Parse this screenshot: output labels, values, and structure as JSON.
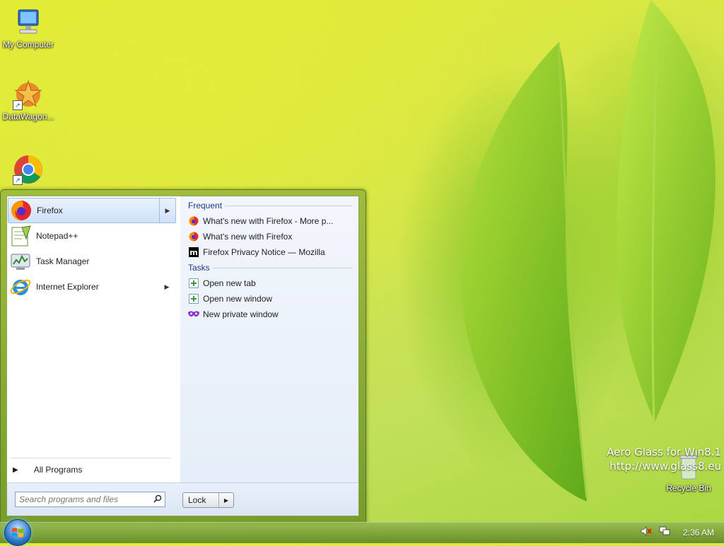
{
  "desktop": {
    "icons": [
      {
        "label": "My Computer",
        "icon": "computer-icon"
      },
      {
        "label": "DataWagon...",
        "icon": "datawagon-icon"
      },
      {
        "label": "",
        "icon": "chrome-icon"
      },
      {
        "label": "Recycle Bin",
        "icon": "recycle-bin-icon"
      }
    ],
    "watermark_line1": "Aero Glass for Win8.1",
    "watermark_line2": "http://www.glass8.eu"
  },
  "start_menu": {
    "programs": [
      {
        "label": "Firefox",
        "icon": "firefox-icon",
        "selected": true,
        "has_submenu": true
      },
      {
        "label": "Notepad++",
        "icon": "notepadpp-icon",
        "selected": false,
        "has_submenu": false
      },
      {
        "label": "Task Manager",
        "icon": "task-manager-icon",
        "selected": false,
        "has_submenu": false
      },
      {
        "label": "Internet Explorer",
        "icon": "internet-explorer-icon",
        "selected": false,
        "has_submenu": true
      }
    ],
    "all_programs": "All Programs",
    "search_placeholder": "Search programs and files",
    "lock_label": "Lock",
    "jump_list": {
      "frequent_header": "Frequent",
      "frequent": [
        {
          "label": "What's new with Firefox - More p...",
          "icon": "firefox-icon"
        },
        {
          "label": "What's new with Firefox",
          "icon": "firefox-icon"
        },
        {
          "label": "Firefox Privacy Notice — Mozilla",
          "icon": "mozilla-icon"
        }
      ],
      "tasks_header": "Tasks",
      "tasks": [
        {
          "label": "Open new tab",
          "icon": "new-tab-icon"
        },
        {
          "label": "Open new window",
          "icon": "new-window-icon"
        },
        {
          "label": "New private window",
          "icon": "private-window-icon"
        }
      ]
    }
  },
  "taskbar": {
    "clock": "2:36 AM"
  }
}
